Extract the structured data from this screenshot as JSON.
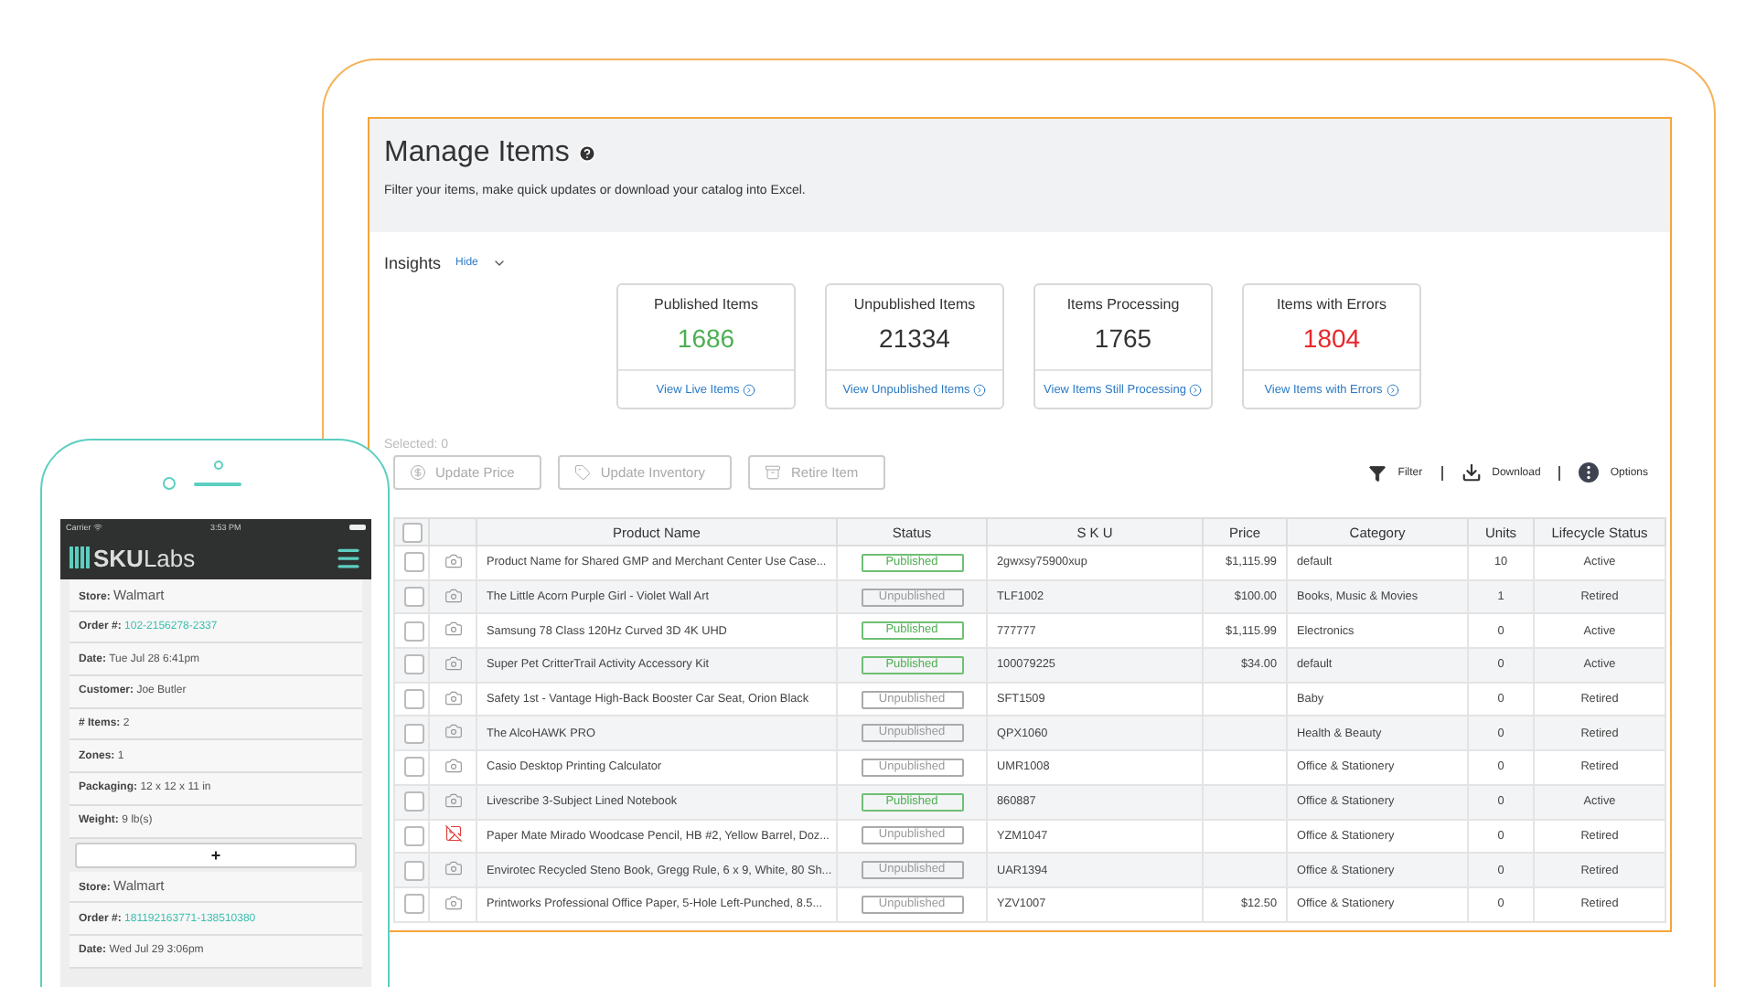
{
  "page": {
    "title": "Manage Items",
    "subtitle": "Filter your items, make quick updates or download your catalog into Excel."
  },
  "insights": {
    "title": "Insights",
    "toggle": "Hide",
    "expanded": true,
    "cards": [
      {
        "label": "Published Items",
        "value": "1686",
        "kind": "good",
        "link": "View Live Items"
      },
      {
        "label": "Unpublished Items",
        "value": "21334",
        "kind": "neutral",
        "link": "View Unpublished Items"
      },
      {
        "label": "Items Processing",
        "value": "1765",
        "kind": "neutral",
        "link": "View Items Still Processing"
      },
      {
        "label": "Items with Errors",
        "value": "1804",
        "kind": "bad",
        "link": "View Items with Errors"
      }
    ]
  },
  "selection": {
    "count_label": "Selected: 0"
  },
  "bulk_actions": [
    {
      "kind": "price",
      "label": "Update Price",
      "disabled": true
    },
    {
      "kind": "inventory",
      "label": "Update Inventory",
      "disabled": true
    },
    {
      "kind": "retire",
      "label": "Retire Item",
      "disabled": true
    }
  ],
  "tools": [
    {
      "kind": "filter",
      "label": "Filter"
    },
    {
      "kind": "download",
      "label": "Download"
    },
    {
      "kind": "options",
      "label": "Options"
    }
  ],
  "table": {
    "all_checked": false,
    "columns": [
      "Product Name",
      "Status",
      "S K U",
      "Price",
      "Category",
      "Units",
      "Lifecycle Status"
    ],
    "rows": [
      {
        "checked": false,
        "kind": "photo",
        "name": "Product Name for Shared GMP and Merchant Center Use Case...",
        "status": "Published",
        "published": true,
        "sku": "2gwxsy75900xup",
        "price": "$1,115.99",
        "category": "default",
        "units": "10",
        "lifecycle": "Active"
      },
      {
        "checked": false,
        "kind": "photo",
        "name": "The Little Acorn Purple Girl - Violet Wall Art",
        "status": "Unpublished",
        "published": false,
        "sku": "TLF1002",
        "price": "$100.00",
        "category": "Books, Music & Movies",
        "units": "1",
        "lifecycle": "Retired"
      },
      {
        "checked": false,
        "kind": "photo",
        "name": "Samsung 78 Class 120Hz Curved 3D 4K UHD",
        "status": "Published",
        "published": true,
        "sku": "777777",
        "price": "$1,115.99",
        "category": "Electronics",
        "units": "0",
        "lifecycle": "Active"
      },
      {
        "checked": false,
        "kind": "photo",
        "name": "Super Pet CritterTrail Activity Accessory Kit",
        "status": "Published",
        "published": true,
        "sku": "100079225",
        "price": "$34.00",
        "category": "default",
        "units": "0",
        "lifecycle": "Active"
      },
      {
        "checked": false,
        "kind": "photo",
        "name": "Safety 1st - Vantage High-Back Booster Car Seat, Orion Black",
        "status": "Unpublished",
        "published": false,
        "sku": "SFT1509",
        "category": "Baby",
        "units": "0",
        "lifecycle": "Retired"
      },
      {
        "checked": false,
        "kind": "photo",
        "name": "The AlcoHAWK PRO",
        "status": "Unpublished",
        "published": false,
        "sku": "QPX1060",
        "category": "Health & Beauty",
        "units": "0",
        "lifecycle": "Retired"
      },
      {
        "checked": false,
        "kind": "photo",
        "name": "Casio Desktop Printing Calculator",
        "status": "Unpublished",
        "published": false,
        "sku": "UMR1008",
        "category": "Office & Stationery",
        "units": "0",
        "lifecycle": "Retired"
      },
      {
        "checked": false,
        "kind": "photo",
        "name": "Livescribe 3-Subject Lined Notebook",
        "status": "Published",
        "published": true,
        "sku": "860887",
        "category": "Office & Stationery",
        "units": "0",
        "lifecycle": "Active"
      },
      {
        "checked": false,
        "kind": "error",
        "name": "Paper Mate Mirado Woodcase Pencil, HB #2, Yellow Barrel, Doz...",
        "status": "Unpublished",
        "published": false,
        "sku": "YZM1047",
        "category": "Office & Stationery",
        "units": "0",
        "lifecycle": "Retired"
      },
      {
        "checked": false,
        "kind": "photo",
        "name": "Envirotec Recycled Steno Book, Gregg Rule, 6 x 9, White, 80 Sh...",
        "status": "Unpublished",
        "published": false,
        "sku": "UAR1394",
        "category": "Office & Stationery",
        "units": "0",
        "lifecycle": "Retired"
      },
      {
        "checked": false,
        "kind": "photo",
        "name": "Printworks Professional Office Paper, 5-Hole Left-Punched, 8.5...",
        "status": "Unpublished",
        "published": false,
        "sku": "YZV1007",
        "price": "$12.50",
        "category": "Office & Stationery",
        "units": "0",
        "lifecycle": "Retired"
      }
    ]
  },
  "phone": {
    "status_bar": {
      "carrier": "Carrier",
      "time": "3:53 PM"
    },
    "logo": "**SKU**Labs",
    "entries": [
      {
        "kind": "store",
        "label": "Store:",
        "value": "Walmart"
      },
      {
        "kind": "link",
        "label": "Order #:",
        "value": "102-2156278-2337"
      },
      {
        "kind": "field",
        "label": "Date:",
        "value": "Tue Jul 28 6:41pm"
      },
      {
        "kind": "field",
        "label": "Customer:",
        "value": "Joe Butler"
      },
      {
        "kind": "field",
        "label": "# Items:",
        "value": "2"
      },
      {
        "kind": "field",
        "label": "Zones:",
        "value": "1"
      },
      {
        "kind": "field",
        "label": "Packaging:",
        "value": "12 x 12 x 11 in"
      },
      {
        "kind": "field",
        "label": "Weight:",
        "value": "9 lb(s)"
      },
      {
        "kind": "add",
        "label": "+"
      },
      {
        "kind": "store",
        "label": "Store:",
        "value": "Walmart"
      },
      {
        "kind": "link",
        "label": "Order #:",
        "value": "181192163771-138510380"
      },
      {
        "kind": "field",
        "label": "Date:",
        "value": "Wed Jul 29 3:06pm"
      }
    ]
  }
}
